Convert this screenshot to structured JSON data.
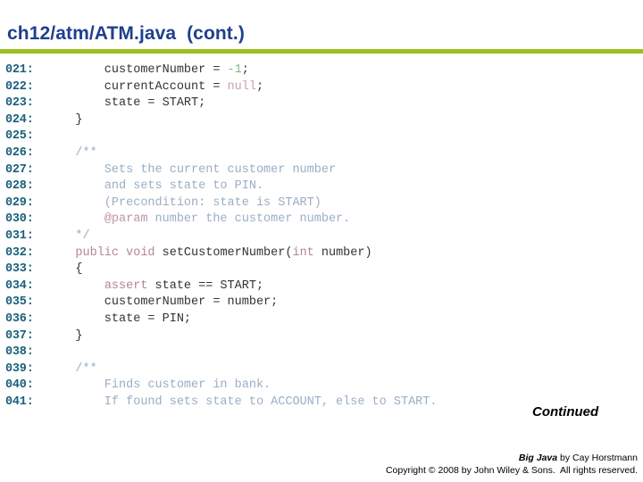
{
  "slide": {
    "title": "ch12/atm/ATM.java  (cont.)",
    "rule_color": "#9ac21c",
    "title_color": "#1f3f8f"
  },
  "colors": {
    "lineno": "#19607a",
    "code": "#333333",
    "keyword": "#b2849b",
    "number": "#86b086",
    "null_literal": "#c8a0b0",
    "comment": "#9aaec4",
    "javadoc_tag": "#c090a8"
  },
  "code": {
    "lines": [
      {
        "no": "021:",
        "tokens": [
          {
            "t": "        customerNumber = ",
            "c": "plain"
          },
          {
            "t": "-1",
            "c": "num"
          },
          {
            "t": ";",
            "c": "plain"
          }
        ]
      },
      {
        "no": "022:",
        "tokens": [
          {
            "t": "        currentAccount = ",
            "c": "plain"
          },
          {
            "t": "null",
            "c": "null"
          },
          {
            "t": ";",
            "c": "plain"
          }
        ]
      },
      {
        "no": "023:",
        "tokens": [
          {
            "t": "        state = START;",
            "c": "plain"
          }
        ]
      },
      {
        "no": "024:",
        "tokens": [
          {
            "t": "    }",
            "c": "plain"
          }
        ]
      },
      {
        "no": "025:",
        "tokens": [
          {
            "t": "",
            "c": "plain"
          }
        ]
      },
      {
        "no": "026:",
        "tokens": [
          {
            "t": "    /**",
            "c": "comment"
          }
        ]
      },
      {
        "no": "027:",
        "tokens": [
          {
            "t": "        Sets the current customer number",
            "c": "comment"
          }
        ]
      },
      {
        "no": "028:",
        "tokens": [
          {
            "t": "        and sets state to PIN.",
            "c": "comment"
          }
        ]
      },
      {
        "no": "029:",
        "tokens": [
          {
            "t": "        (Precondition: state is START)",
            "c": "comment"
          }
        ]
      },
      {
        "no": "030:",
        "tokens": [
          {
            "t": "        ",
            "c": "comment"
          },
          {
            "t": "@param",
            "c": "tag"
          },
          {
            "t": " number the customer number.",
            "c": "comment"
          }
        ]
      },
      {
        "no": "031:",
        "tokens": [
          {
            "t": "    */",
            "c": "comment"
          }
        ]
      },
      {
        "no": "032:",
        "tokens": [
          {
            "t": "    ",
            "c": "plain"
          },
          {
            "t": "public void",
            "c": "kw"
          },
          {
            "t": " setCustomerNumber(",
            "c": "plain"
          },
          {
            "t": "int",
            "c": "kw"
          },
          {
            "t": " number)",
            "c": "plain"
          }
        ]
      },
      {
        "no": "033:",
        "tokens": [
          {
            "t": "    {",
            "c": "plain"
          }
        ]
      },
      {
        "no": "034:",
        "tokens": [
          {
            "t": "        ",
            "c": "plain"
          },
          {
            "t": "assert",
            "c": "kw"
          },
          {
            "t": " state == START;",
            "c": "plain"
          }
        ]
      },
      {
        "no": "035:",
        "tokens": [
          {
            "t": "        customerNumber = number;",
            "c": "plain"
          }
        ]
      },
      {
        "no": "036:",
        "tokens": [
          {
            "t": "        state = PIN;",
            "c": "plain"
          }
        ]
      },
      {
        "no": "037:",
        "tokens": [
          {
            "t": "    }",
            "c": "plain"
          }
        ]
      },
      {
        "no": "038:",
        "tokens": [
          {
            "t": "",
            "c": "plain"
          }
        ]
      },
      {
        "no": "039:",
        "tokens": [
          {
            "t": "    /**",
            "c": "comment"
          }
        ]
      },
      {
        "no": "040:",
        "tokens": [
          {
            "t": "        Finds customer in bank.",
            "c": "comment"
          }
        ]
      },
      {
        "no": "041:",
        "tokens": [
          {
            "t": "        If found sets state to ACCOUNT, else to START.",
            "c": "comment"
          }
        ]
      }
    ]
  },
  "continued": {
    "label": "Continued"
  },
  "footer": {
    "book_title": "Big Java",
    "book_by": " by Cay Horstmann",
    "copyright": "Copyright © 2008 by John Wiley & Sons.  All rights reserved."
  }
}
